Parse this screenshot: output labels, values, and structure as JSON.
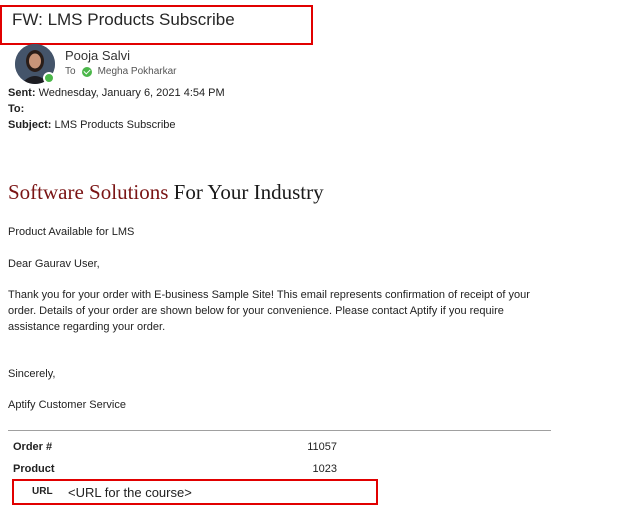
{
  "email": {
    "subject_title": "FW: LMS Products Subscribe",
    "sender_name": "Pooja Salvi",
    "to_prefix": "To",
    "to_recipient": "Megha Pokharkar",
    "sent_label": "Sent:",
    "sent_value": "Wednesday, January 6, 2021 4:54 PM",
    "to_label": "To:",
    "to_value": "",
    "subject_label": "Subject:",
    "subject_value": "LMS Products Subscribe"
  },
  "body": {
    "headline_accent": "Software Solutions",
    "headline_rest": "For Your Industry",
    "product_line": "Product Available for LMS",
    "greeting": "Dear Gaurav User,",
    "paragraph": "Thank you for your order with E-business Sample Site! This email represents confirmation of receipt of your order. Details of your order are shown below for your convenience. Please contact Aptify if you require assistance regarding your order.",
    "closing": "Sincerely,",
    "signature": "Aptify Customer Service"
  },
  "order_table": {
    "order_label": "Order #",
    "order_value": "11057",
    "product_label": "Product",
    "product_value": "1023",
    "url_label": "URL",
    "url_value": "<URL for the course>"
  },
  "colors": {
    "highlight": "#e10000",
    "headline_accent": "#7a1414",
    "presence_green": "#4bb74a"
  },
  "icons": {
    "avatar": "avatar",
    "presence": "presence-available-icon",
    "recipient_status": "available-check-icon"
  }
}
